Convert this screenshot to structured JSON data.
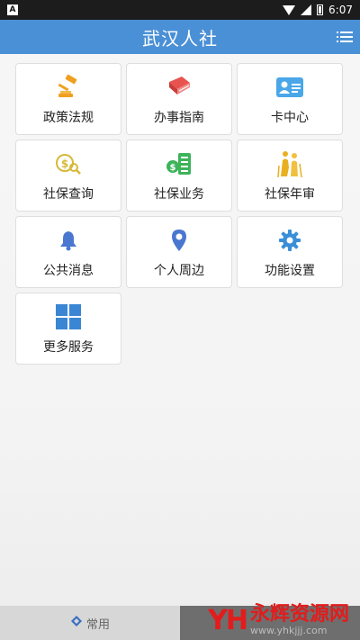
{
  "status_bar": {
    "time": "6:07",
    "notification_glyph": "A"
  },
  "header": {
    "title": "武汉人社"
  },
  "tiles": [
    {
      "label": "政策法规",
      "icon": "gavel-icon",
      "color": "#f0a020"
    },
    {
      "label": "办事指南",
      "icon": "book-icon",
      "color": "#e8534f"
    },
    {
      "label": "卡中心",
      "icon": "id-card-icon",
      "color": "#4aa7e8"
    },
    {
      "label": "社保查询",
      "icon": "money-search-icon",
      "color": "#d6b93a"
    },
    {
      "label": "社保业务",
      "icon": "money-list-icon",
      "color": "#3db35a"
    },
    {
      "label": "社保年审",
      "icon": "elderly-couple-icon",
      "color": "#e8b020"
    },
    {
      "label": "公共消息",
      "icon": "bell-icon",
      "color": "#4a78d0"
    },
    {
      "label": "个人周边",
      "icon": "location-pin-icon",
      "color": "#4a78d0"
    },
    {
      "label": "功能设置",
      "icon": "gear-icon",
      "color": "#3a8fd8"
    },
    {
      "label": "更多服务",
      "icon": "grid-icon",
      "color": "#3a86d4"
    }
  ],
  "bottom_nav": {
    "active_label": "常用"
  },
  "watermark": {
    "logo": "YH",
    "title": "永辉资源网",
    "url": "www.yhkjjj.com"
  }
}
